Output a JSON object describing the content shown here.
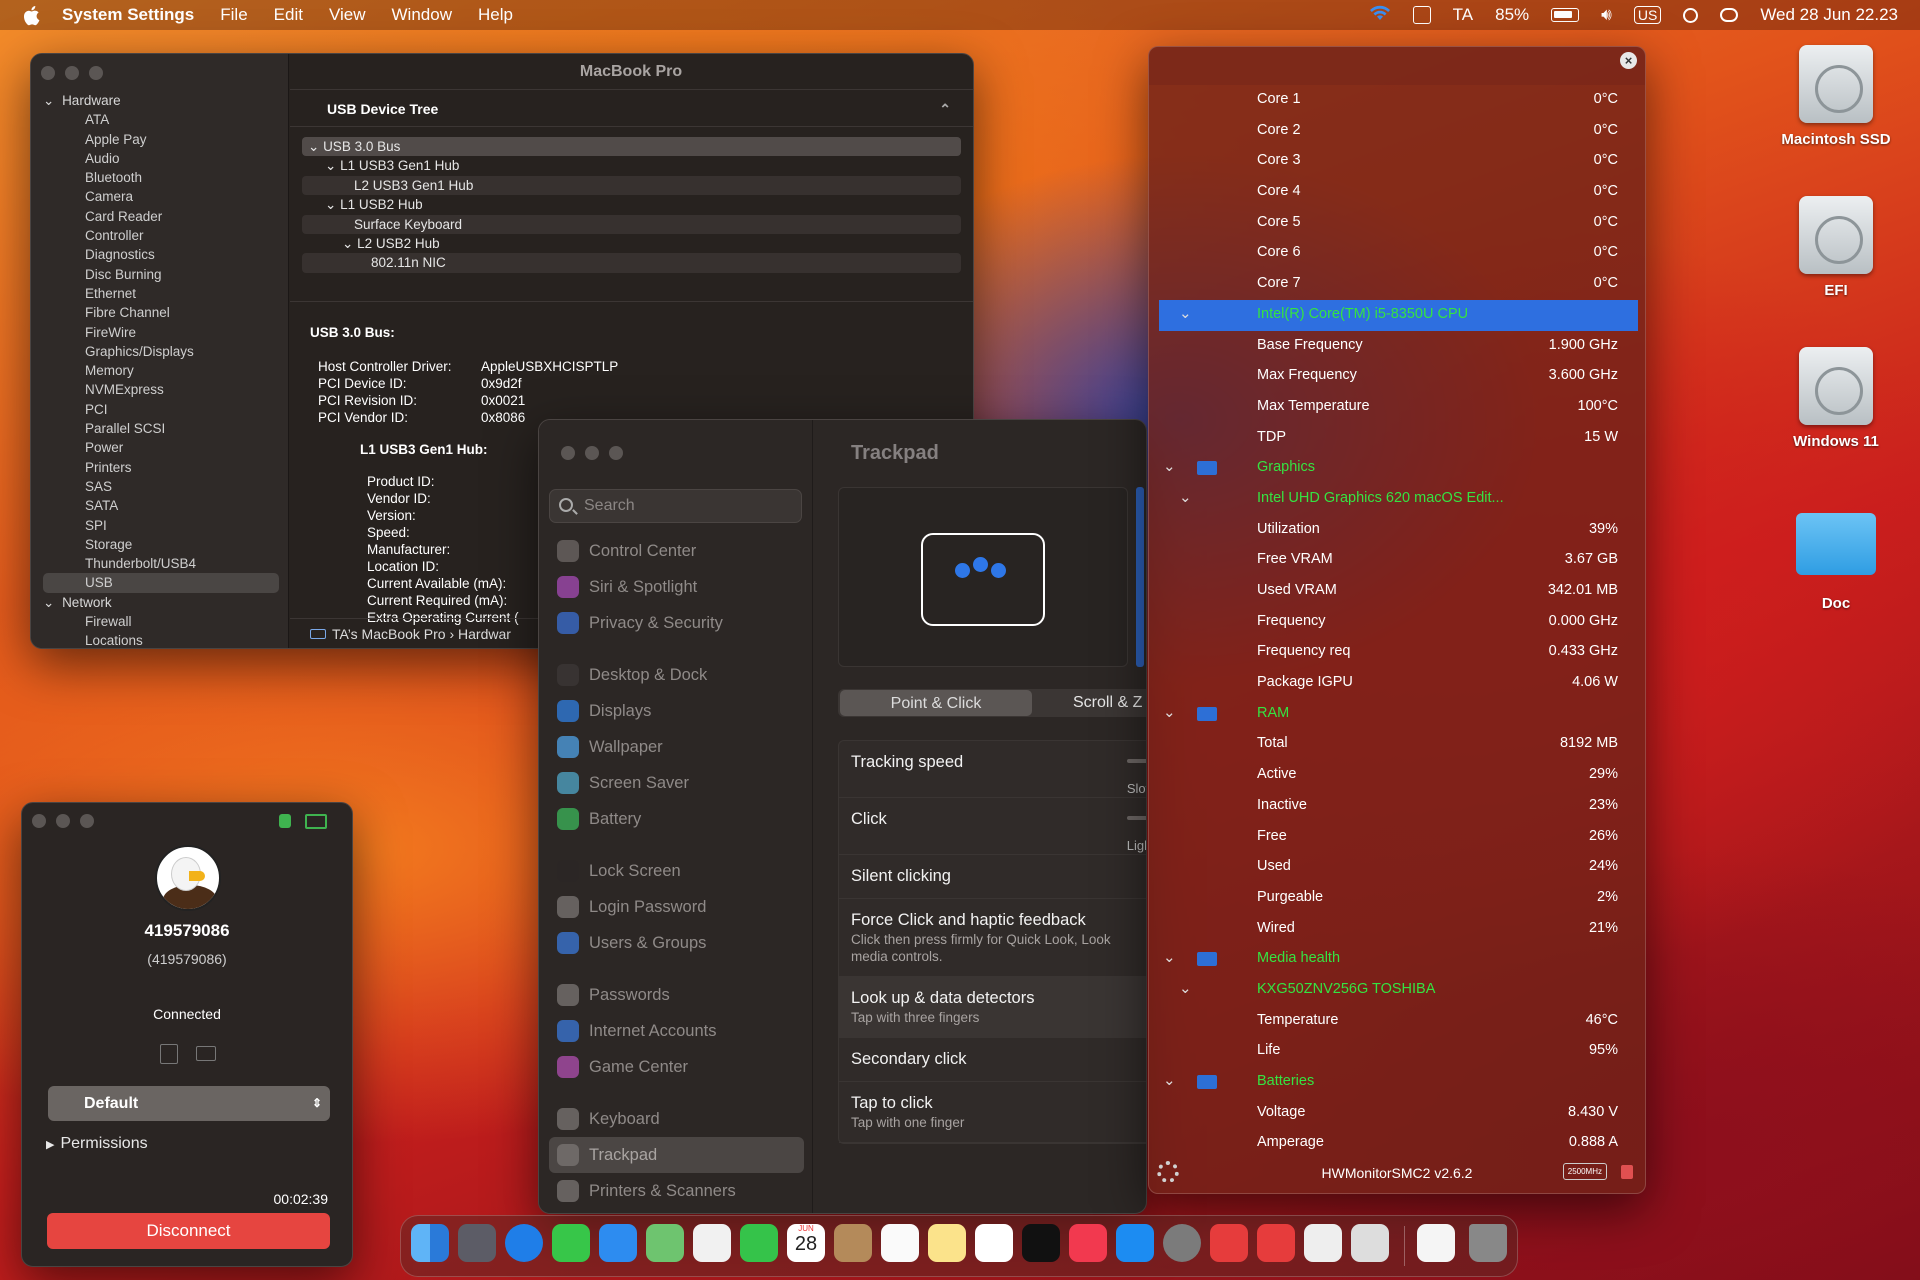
{
  "menubar": {
    "app": "System Settings",
    "items": [
      "File",
      "Edit",
      "View",
      "Window",
      "Help"
    ],
    "user": "TA",
    "battery": "85%",
    "input": "US",
    "datetime": "Wed 28 Jun  22.23"
  },
  "sysinfo": {
    "title": "MacBook Pro",
    "sidebar": [
      {
        "label": "Hardware",
        "group": true
      },
      {
        "label": "ATA"
      },
      {
        "label": "Apple Pay"
      },
      {
        "label": "Audio"
      },
      {
        "label": "Bluetooth"
      },
      {
        "label": "Camera"
      },
      {
        "label": "Card Reader"
      },
      {
        "label": "Controller"
      },
      {
        "label": "Diagnostics"
      },
      {
        "label": "Disc Burning"
      },
      {
        "label": "Ethernet"
      },
      {
        "label": "Fibre Channel"
      },
      {
        "label": "FireWire"
      },
      {
        "label": "Graphics/Displays"
      },
      {
        "label": "Memory"
      },
      {
        "label": "NVMExpress"
      },
      {
        "label": "PCI"
      },
      {
        "label": "Parallel SCSI"
      },
      {
        "label": "Power"
      },
      {
        "label": "Printers"
      },
      {
        "label": "SAS"
      },
      {
        "label": "SATA"
      },
      {
        "label": "SPI"
      },
      {
        "label": "Storage"
      },
      {
        "label": "Thunderbolt/USB4"
      },
      {
        "label": "USB",
        "selected": true
      },
      {
        "label": "Network",
        "group": true
      },
      {
        "label": "Firewall"
      },
      {
        "label": "Locations"
      }
    ],
    "section": "USB Device Tree",
    "tree": [
      {
        "label": "USB 3.0 Bus",
        "level": 0,
        "chev": true
      },
      {
        "label": "L1 USB3 Gen1 Hub",
        "level": 1,
        "chev": true
      },
      {
        "label": "L2 USB3 Gen1 Hub",
        "level": 2
      },
      {
        "label": "L1 USB2 Hub",
        "level": 1,
        "chev": true
      },
      {
        "label": "Surface Keyboard",
        "level": 2
      },
      {
        "label": "L2 USB2 Hub",
        "level": 2,
        "chev": true
      },
      {
        "label": "802.11n NIC",
        "level": 3
      }
    ],
    "detail_title": "USB 3.0 Bus:",
    "detail": [
      [
        "Host Controller Driver:",
        "AppleUSBXHCISPTLP"
      ],
      [
        "PCI Device ID:",
        "0x9d2f"
      ],
      [
        "PCI Revision ID:",
        "0x0021"
      ],
      [
        "PCI Vendor ID:",
        "0x8086"
      ]
    ],
    "sub_title": "L1 USB3 Gen1 Hub:",
    "sub_fields": [
      "Product ID:",
      "Vendor ID:",
      "Version:",
      "Speed:",
      "Manufacturer:",
      "Location ID:",
      "Current Available (mA):",
      "Current Required (mA):",
      "Extra Operating Current ("
    ],
    "breadcrumb": "TA’s MacBook Pro  ›  Hardwar"
  },
  "settings": {
    "search": "Search",
    "title": "Trackpad",
    "items": [
      [
        "Control Center",
        "#6d6866"
      ],
      [
        "Siri & Spotlight",
        "#a54bb6"
      ],
      [
        "Privacy & Security",
        "#3a6fd1"
      ],
      null,
      [
        "Desktop & Dock",
        "#3c3837"
      ],
      [
        "Displays",
        "#2f7fe0"
      ],
      [
        "Wallpaper",
        "#4ea1e6"
      ],
      [
        "Screen Saver",
        "#4fa7c8"
      ],
      [
        "Battery",
        "#3bb75a"
      ],
      null,
      [
        "Lock Screen",
        "#2b2725"
      ],
      [
        "Login Password",
        "#7a7573"
      ],
      [
        "Users & Groups",
        "#3a78d8"
      ],
      null,
      [
        "Passwords",
        "#7a7573"
      ],
      [
        "Internet Accounts",
        "#3a78d8"
      ],
      [
        "Game Center",
        "#b04fb0"
      ],
      null,
      [
        "Keyboard",
        "#7a7573"
      ],
      [
        "Trackpad",
        "#7a7573"
      ],
      [
        "Printers & Scanners",
        "#7a7573"
      ]
    ],
    "selected": "Trackpad",
    "tabs": [
      "Point & Click",
      "Scroll & Z"
    ],
    "options": [
      {
        "label": "Tracking speed",
        "slider": "Slow"
      },
      {
        "label": "Click",
        "slider": "Light"
      },
      {
        "label": "Silent clicking"
      },
      {
        "label": "Force Click and haptic feedback",
        "sub": "Click then press firmly for Quick Look, Look",
        "sub2": "media controls."
      },
      {
        "label": "Look up & data detectors",
        "sub": "Tap with three fingers"
      },
      {
        "label": "Secondary click"
      },
      {
        "label": "Tap to click",
        "sub": "Tap with one finger"
      }
    ]
  },
  "hw": {
    "rows": [
      {
        "l": "Core 1",
        "v": "0°C"
      },
      {
        "l": "Core 2",
        "v": "0°C"
      },
      {
        "l": "Core 3",
        "v": "0°C"
      },
      {
        "l": "Core 4",
        "v": "0°C"
      },
      {
        "l": "Core 5",
        "v": "0°C"
      },
      {
        "l": "Core 6",
        "v": "0°C"
      },
      {
        "l": "Core 7",
        "v": "0°C"
      },
      {
        "l": "Intel(R) Core(TM) i5-8350U CPU",
        "v": "",
        "type": "hl"
      },
      {
        "l": "Base Frequency",
        "v": "1.900 GHz"
      },
      {
        "l": "Max Frequency",
        "v": "3.600 GHz"
      },
      {
        "l": "Max Temperature",
        "v": "100°C"
      },
      {
        "l": "TDP",
        "v": "15 W"
      },
      {
        "l": "Graphics",
        "v": "",
        "type": "cat"
      },
      {
        "l": "Intel UHD Graphics 620 macOS Edit...",
        "v": "",
        "type": "sub"
      },
      {
        "l": "Utilization",
        "v": "39%"
      },
      {
        "l": "Free VRAM",
        "v": "3.67 GB"
      },
      {
        "l": "Used VRAM",
        "v": "342.01 MB"
      },
      {
        "l": "Frequency",
        "v": "0.000 GHz"
      },
      {
        "l": "Frequency req",
        "v": "0.433 GHz"
      },
      {
        "l": "Package IGPU",
        "v": "4.06 W"
      },
      {
        "l": "RAM",
        "v": "",
        "type": "cat"
      },
      {
        "l": "Total",
        "v": "8192 MB"
      },
      {
        "l": "Active",
        "v": "29%"
      },
      {
        "l": "Inactive",
        "v": "23%"
      },
      {
        "l": "Free",
        "v": "26%"
      },
      {
        "l": "Used",
        "v": "24%"
      },
      {
        "l": "Purgeable",
        "v": "2%"
      },
      {
        "l": "Wired",
        "v": "21%"
      },
      {
        "l": "Media health",
        "v": "",
        "type": "cat"
      },
      {
        "l": "KXG50ZNV256G TOSHIBA",
        "v": "",
        "type": "sub"
      },
      {
        "l": "Temperature",
        "v": "46°C"
      },
      {
        "l": "Life",
        "v": "95%"
      },
      {
        "l": "Batteries",
        "v": "",
        "type": "cat"
      },
      {
        "l": "Voltage",
        "v": "8.430 V"
      },
      {
        "l": "Amperage",
        "v": "0.888 A"
      }
    ],
    "version": "HWMonitorSMC2 v2.6.2",
    "badge": "2500MHz"
  },
  "vpn": {
    "name": "419579086",
    "id": "(419579086)",
    "status": "Connected",
    "profile": "Default",
    "permissions": "Permissions",
    "timer": "00:02:39",
    "disconnect": "Disconnect"
  },
  "desktop": [
    "Macintosh SSD",
    "EFI",
    "Windows 11",
    "Doc"
  ],
  "dock": {
    "date_month": "JUN",
    "date_day": "28"
  }
}
